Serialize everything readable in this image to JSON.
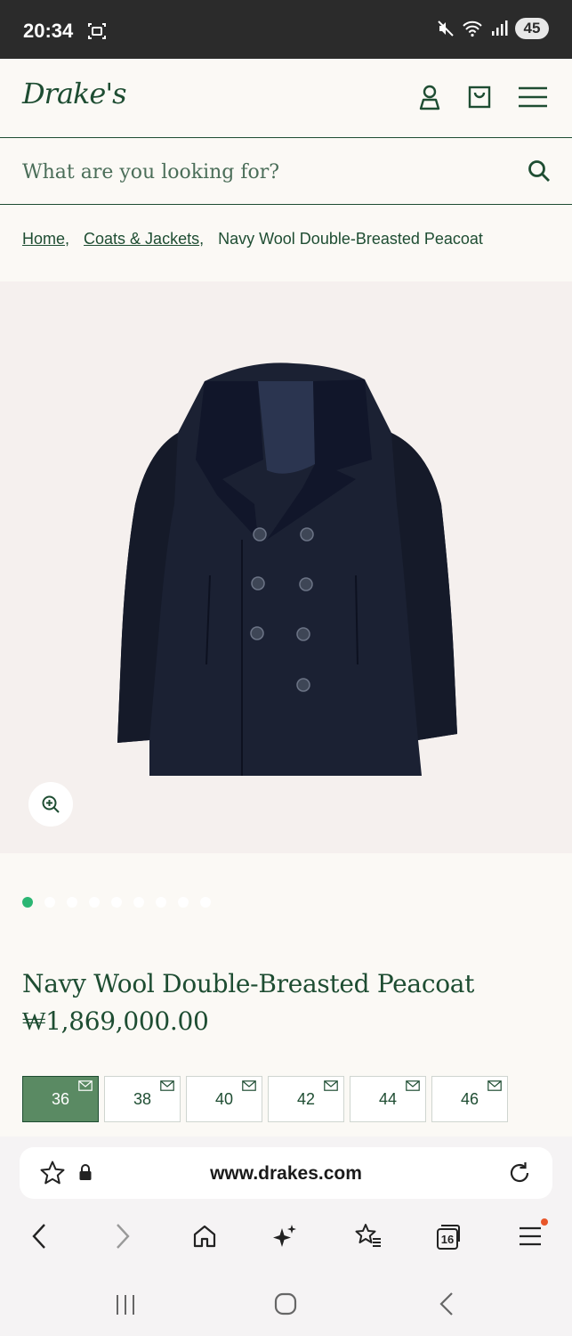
{
  "status_bar": {
    "time": "20:34",
    "battery": "45"
  },
  "header": {
    "logo": "Drake's"
  },
  "search": {
    "placeholder": "What are you looking for?"
  },
  "breadcrumb": {
    "items": [
      "Home",
      "Coats & Jackets",
      "Navy Wool Double-Breasted Peacoat"
    ],
    "separator": ","
  },
  "product": {
    "title": "Navy Wool Double-Breasted Peacoat",
    "price": "₩1,869,000.00",
    "image_count": 9,
    "active_image": 1,
    "sizes": [
      {
        "label": "36",
        "selected": true
      },
      {
        "label": "38",
        "selected": false
      },
      {
        "label": "40",
        "selected": false
      },
      {
        "label": "42",
        "selected": false
      },
      {
        "label": "44",
        "selected": false
      },
      {
        "label": "46",
        "selected": false
      }
    ]
  },
  "browser": {
    "url": "www.drakes.com",
    "tab_count": "16"
  },
  "colors": {
    "brand_green": "#1e4d32",
    "selected_size": "#5a8a63",
    "active_dot": "#2bb673",
    "image_bg": "#f5f0ee"
  }
}
